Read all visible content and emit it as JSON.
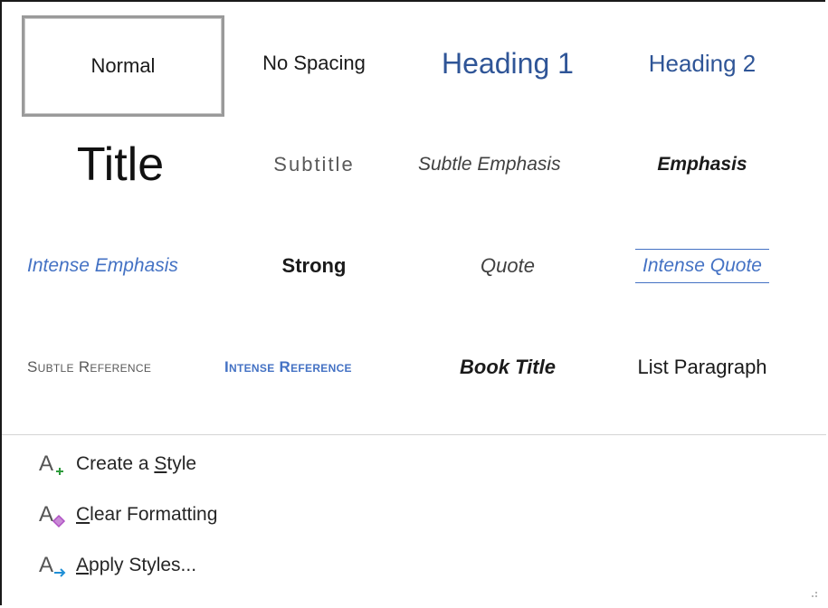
{
  "styles": {
    "normal": "Normal",
    "no_spacing": "No Spacing",
    "heading1": "Heading 1",
    "heading2": "Heading 2",
    "title": "Title",
    "subtitle": "Subtitle",
    "subtle_emphasis": "Subtle Emphasis",
    "emphasis": "Emphasis",
    "intense_emphasis": "Intense Emphasis",
    "strong": "Strong",
    "quote": "Quote",
    "intense_quote": "Intense Quote",
    "subtle_reference": "Subtle Reference",
    "intense_reference": "Intense Reference",
    "book_title": "Book Title",
    "list_paragraph": "List Paragraph"
  },
  "commands": {
    "create_style": {
      "before": "Create a ",
      "key": "S",
      "after": "tyle"
    },
    "clear_formatting": {
      "before": "",
      "key": "C",
      "after": "lear Formatting"
    },
    "apply_styles": {
      "before": "",
      "key": "A",
      "after": "pply Styles..."
    }
  },
  "colors": {
    "heading_blue": "#2f5597",
    "accent_blue": "#4472c4",
    "subtitle_gray": "#595959",
    "selected_border": "#9a9a9a",
    "create_plus": "#2e9b3c",
    "eraser_purple": "#b052c4",
    "apply_arrow": "#1f8fd6"
  }
}
